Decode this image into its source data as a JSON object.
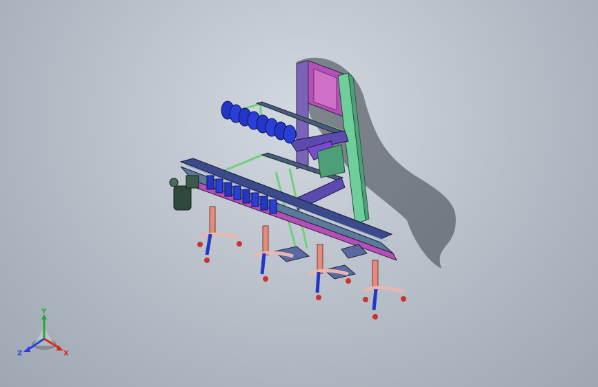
{
  "viewport": {
    "background_top": "#d2d8df",
    "background_bottom": "#9ea7b2"
  },
  "triad": {
    "x_label": "X",
    "y_label": "Y",
    "z_label": "Z",
    "x_color": "#e0261b",
    "y_color": "#22a83a",
    "z_color": "#2a3fe0"
  },
  "model": {
    "frame_color": "#6fcf7a",
    "beam_color": "#3a4a8a",
    "accent_color": "#c23ec0",
    "leg_color": "#e58a7c",
    "foot_color": "#d12f2f"
  }
}
